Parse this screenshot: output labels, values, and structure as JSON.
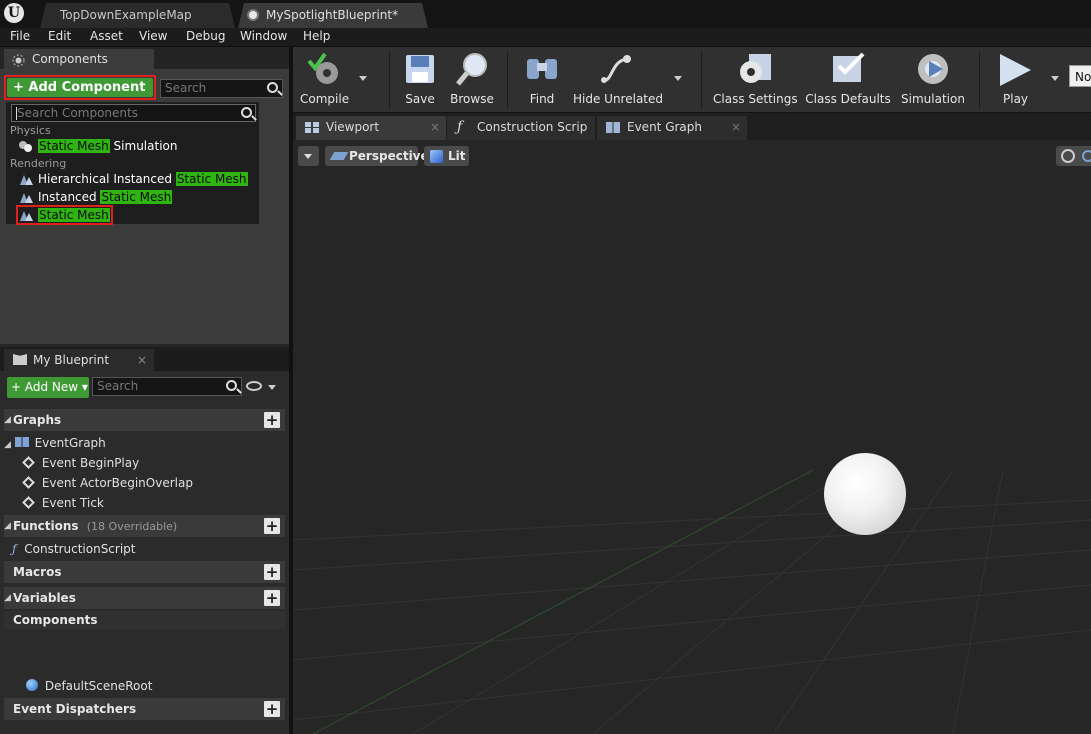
{
  "app": {
    "logo": "U"
  },
  "doc_tabs": [
    {
      "label": "TopDownExampleMap"
    },
    {
      "label": "MySpotlightBlueprint*"
    }
  ],
  "menu": [
    "File",
    "Edit",
    "Asset",
    "View",
    "Debug",
    "Window",
    "Help"
  ],
  "components_panel": {
    "title": "Components",
    "add_component": "+ Add Component ▾",
    "search_placeholder": "Search",
    "dropdown": {
      "search_placeholder": "Search Components",
      "categories": [
        {
          "name": "Physics",
          "items": [
            {
              "pre": "",
              "hl": "Static Mesh",
              "post": " Simulation",
              "hl2": ""
            }
          ]
        },
        {
          "name": "Rendering",
          "items": [
            {
              "pre": "Hierarchical Instanced ",
              "hl": "Static Mesh",
              "post": "",
              "hl2": ""
            },
            {
              "pre": "Instanced ",
              "hl": "Static Mesh",
              "post": "",
              "hl2": ""
            },
            {
              "pre": "",
              "hl": "Static Mesh",
              "post": "",
              "hl2": ""
            }
          ]
        }
      ]
    }
  },
  "my_blueprint": {
    "title": "My Blueprint",
    "add_new": "+ Add New ▾",
    "search_placeholder": "Search",
    "sections": {
      "graphs": "Graphs",
      "functions": "Functions",
      "functions_note": "(18 Overridable)",
      "macros": "Macros",
      "variables": "Variables",
      "components": "Components",
      "event_dispatchers": "Event Dispatchers"
    },
    "items": {
      "event_graph": "EventGraph",
      "begin_play": "Event BeginPlay",
      "begin_overlap": "Event ActorBeginOverlap",
      "tick": "Event Tick",
      "construction_script": "ConstructionScript",
      "default_scene_root": "DefaultSceneRoot"
    }
  },
  "toolbar": {
    "compile": "Compile",
    "save": "Save",
    "browse": "Browse",
    "find": "Find",
    "hide_unrelated": "Hide Unrelated",
    "class_settings": "Class Settings",
    "class_defaults": "Class Defaults",
    "simulation": "Simulation",
    "play": "Play",
    "debug_filter": "No"
  },
  "editor_tabs": [
    "Viewport",
    "Construction Scrip",
    "Event Graph"
  ],
  "viewport": {
    "perspective": "Perspective",
    "lit": "Lit"
  },
  "colors": {
    "accent_green": "#3f9a35",
    "highlight": "#2fb512",
    "selection_red": "#e0201a"
  }
}
